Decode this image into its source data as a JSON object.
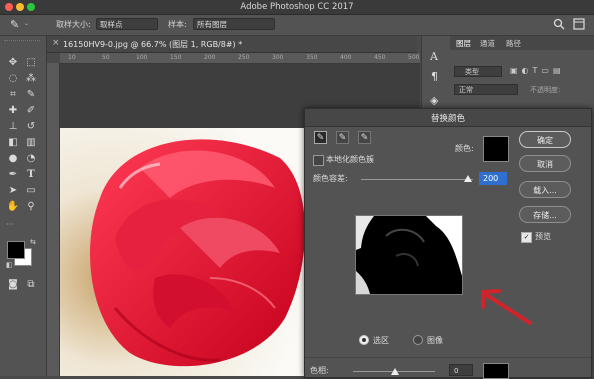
{
  "window": {
    "app_title": "Adobe Photoshop CC 2017"
  },
  "options_bar": {
    "sample_size_label": "取样大小:",
    "sample_size_value": "取样点",
    "sample_label": "样本:",
    "sample_value": "所有图层"
  },
  "document": {
    "tab_label": "16150HV9-0.jpg @ 66.7% (图层 1, RGB/8#) *"
  },
  "ruler": {
    "ticks": [
      "10",
      "50",
      "100",
      "150",
      "200",
      "250",
      "300",
      "350",
      "400",
      "450",
      "500"
    ]
  },
  "panels": {
    "tabs": [
      "图层",
      "通道",
      "路径"
    ],
    "kind_filter": "类型",
    "blend_mode": "正常",
    "opacity_label": "不透明度:"
  },
  "dialog": {
    "title": "替换颜色",
    "ok": "确定",
    "cancel": "取消",
    "load": "载入...",
    "save": "存储...",
    "preview_label": "预览",
    "localized_label": "本地化颜色簇",
    "color_label": "颜色:",
    "fuzziness_label": "颜色容差:",
    "fuzziness_value": "200",
    "selection_radio": "选区",
    "image_radio": "图像",
    "hue_label": "色相:",
    "hue_value": "0"
  },
  "colors": {
    "ui_dark": "#535353",
    "accent_blue": "#2f6fd0",
    "arrow_red": "#d0242a",
    "rose": "#e01432"
  }
}
